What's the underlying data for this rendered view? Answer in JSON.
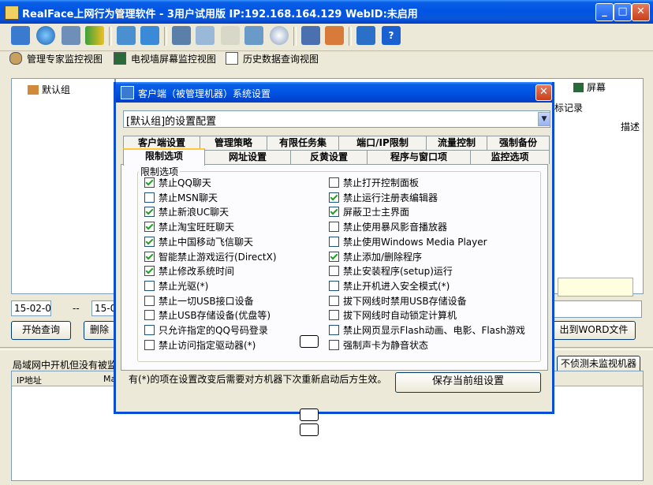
{
  "app": {
    "title": "RealFace上网行为管理软件 - 3用户试用版  IP:192.168.164.129 WebID:未启用"
  },
  "toolbar_icons": [
    "monitor-group-icon",
    "globe-icon",
    "settings-icon",
    "users-icon",
    "network-icon",
    "info-icon",
    "screen-icon",
    "mail-icon",
    "document-icon",
    "network-map-icon",
    "disk-icon",
    "book-icon",
    "chart-icon",
    "cart-icon",
    "help-icon"
  ],
  "view_tabs": [
    "管理专家监控视图",
    "电视墙屏幕监控视图",
    "历史数据查询视图"
  ],
  "left_tree": {
    "root": "默认组"
  },
  "behind": {
    "screen_tab": "屏幕",
    "target_record": "标记录",
    "desc_col": "描述",
    "date1": "15-02-0",
    "dash": "--",
    "date2": "15-0",
    "query_btn": "开始查询",
    "delete_btn": "删除",
    "word_btn": "出到WORD文件",
    "status_text": "局域网中开机但没有被监",
    "unmonitored_btn": "不侦测未监视机器",
    "col_ip": "IP地址",
    "col_ma": "Ma"
  },
  "dialog": {
    "title": "客户端（被管理机器）系统设置",
    "config_select": "[默认组]的设置配置",
    "tabs_row1": [
      "客户端设置",
      "管理策略",
      "有限任务集",
      "端口/IP限制",
      "流量控制",
      "强制备份"
    ],
    "tabs_row2": [
      "限制选项",
      "网址设置",
      "反黄设置",
      "程序与窗口项",
      "监控选项"
    ],
    "active_tab": "限制选项",
    "group_label": "限制选项",
    "left_options": [
      {
        "label": "禁止QQ聊天",
        "checked": true
      },
      {
        "label": "禁止MSN聊天",
        "checked": false
      },
      {
        "label": "禁止新浪UC聊天",
        "checked": true
      },
      {
        "label": "禁止淘宝旺旺聊天",
        "checked": true
      },
      {
        "label": "禁止中国移动飞信聊天",
        "checked": true
      },
      {
        "label": "智能禁止游戏运行(DirectX)",
        "checked": true
      },
      {
        "label": "禁止修改系统时间",
        "checked": true
      },
      {
        "label": "禁止光驱(*)",
        "checked": false
      },
      {
        "label": "禁止一切USB接口设备",
        "checked": false
      },
      {
        "label": "禁止USB存储设备(优盘等)",
        "checked": false
      },
      {
        "label": "只允许指定的QQ号码登录",
        "checked": false
      },
      {
        "label": "禁止访问指定驱动器(*)",
        "checked": false
      }
    ],
    "right_options": [
      {
        "label": "禁止打开控制面板",
        "checked": false
      },
      {
        "label": "禁止运行注册表编辑器",
        "checked": true
      },
      {
        "label": "屏蔽卫士主界面",
        "checked": true
      },
      {
        "label": "禁止使用暴风影音播放器",
        "checked": false
      },
      {
        "label": "禁止使用Windows Media Player",
        "checked": false
      },
      {
        "label": "禁止添加/删除程序",
        "checked": true
      },
      {
        "label": "禁止安装程序(setup)运行",
        "checked": false
      },
      {
        "label": "禁止开机进入安全模式(*)",
        "checked": false
      },
      {
        "label": "拔下网线时禁用USB存储设备",
        "checked": false
      },
      {
        "label": "拔下网线时自动锁定计算机",
        "checked": false
      },
      {
        "label": "禁止网页显示Flash动画、电影、Flash游戏",
        "checked": false
      },
      {
        "label": "强制声卡为静音状态",
        "checked": false
      }
    ],
    "note": "有(*)的项在设置改变后需要对方机器下次重新启动后方生效。",
    "save_button": "保存当前组设置"
  }
}
